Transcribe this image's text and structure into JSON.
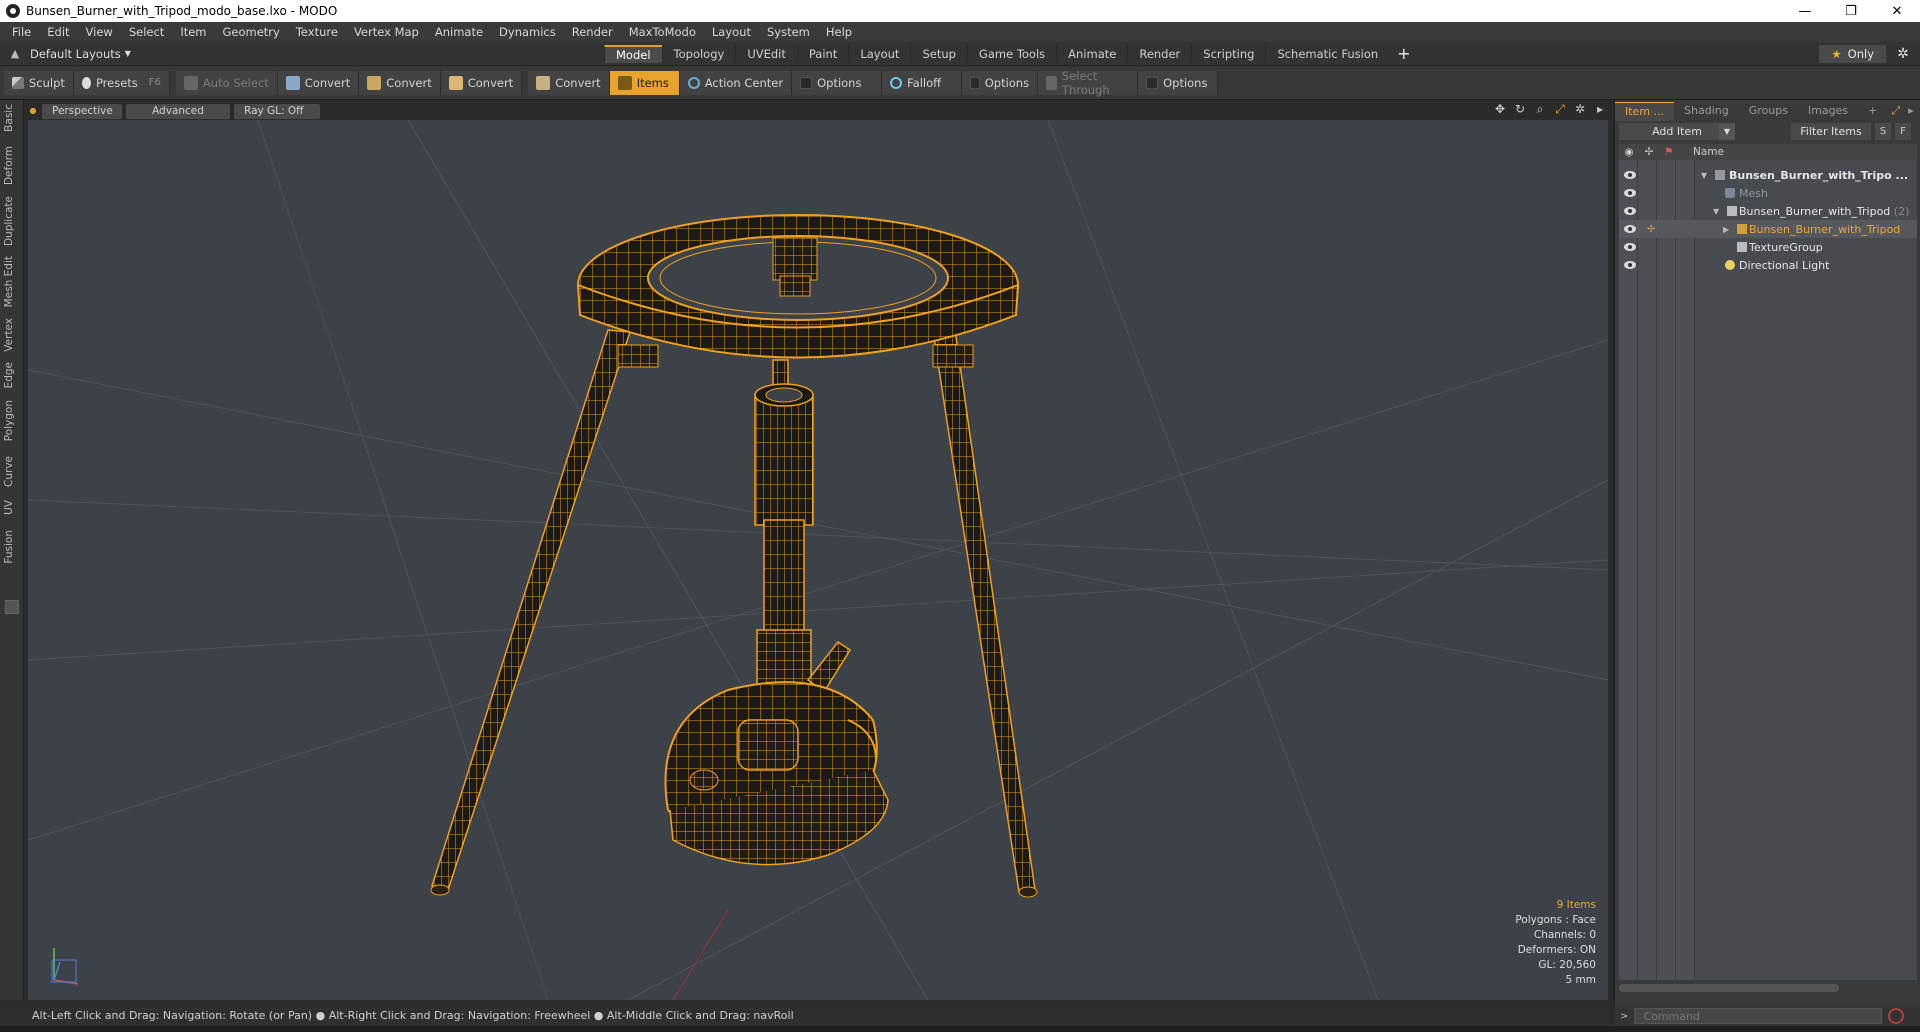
{
  "window": {
    "title": "Bunsen_Burner_with_Tripod_modo_base.lxo - MODO",
    "minimize": "—",
    "maximize": "❐",
    "close": "✕"
  },
  "menu": [
    "File",
    "Edit",
    "View",
    "Select",
    "Item",
    "Geometry",
    "Texture",
    "Vertex Map",
    "Animate",
    "Dynamics",
    "Render",
    "MaxToModo",
    "Layout",
    "System",
    "Help"
  ],
  "layout_bar": {
    "layout_select": "Default Layouts",
    "tabs": [
      "Model",
      "Topology",
      "UVEdit",
      "Paint",
      "Layout",
      "Setup",
      "Game Tools",
      "Animate",
      "Render",
      "Scripting",
      "Schematic Fusion"
    ],
    "active_tab": "Model",
    "add_tab": "+",
    "only_label": "Only"
  },
  "toolbar": {
    "sculpt": "Sculpt",
    "presets": "Presets",
    "presets_shortcut": "F6",
    "auto_select": "Auto Select",
    "convert1": "Convert",
    "convert2": "Convert",
    "convert3": "Convert",
    "convert4": "Convert",
    "items": "Items",
    "action_center": "Action Center",
    "options1": "Options",
    "falloff": "Falloff",
    "options2": "Options",
    "select_through": "Select Through",
    "options3": "Options"
  },
  "left_tabs": [
    "Basic",
    "Deform",
    "Duplicate",
    "Mesh Edit",
    "Vertex",
    "Edge",
    "Polygon",
    "Curve",
    "UV",
    "Fusion"
  ],
  "viewport": {
    "view_mode": "Perspective",
    "shading": "Advanced",
    "raygl": "Ray GL: Off",
    "stats": {
      "items": "9 Items",
      "polygons": "Polygons : Face",
      "channels": "Channels: 0",
      "deformers": "Deformers: ON",
      "gl": "GL: 20,560",
      "scale": "5 mm"
    },
    "wire_color": "#f0a020",
    "bg_color": "#3c4247"
  },
  "status": {
    "hint1": "Alt-Left Click and Drag: Navigation: Rotate (or Pan)",
    "hint2": "Alt-Right Click and Drag: Navigation: Freewheel",
    "hint3": "Alt-Middle Click and Drag: navRoll"
  },
  "right_panel": {
    "tabs": [
      "Item ...",
      "Shading",
      "Groups",
      "Images",
      "+"
    ],
    "add_item": "Add Item",
    "filter_items": "Filter Items",
    "s_btn": "S",
    "f_btn": "F",
    "name_col": "Name",
    "tree": [
      {
        "label": "Bunsen_Burner_with_Tripo ...",
        "style": "bold"
      },
      {
        "label": "Mesh",
        "style": "dim"
      },
      {
        "label": "Bunsen_Burner_with_Tripod",
        "count": "(2)",
        "style": "normal"
      },
      {
        "label": "Bunsen_Burner_with_Tripod",
        "style": "hl"
      },
      {
        "label": "TextureGroup",
        "style": "normal"
      },
      {
        "label": "Directional Light",
        "style": "normal"
      }
    ],
    "command_placeholder": "Command"
  }
}
